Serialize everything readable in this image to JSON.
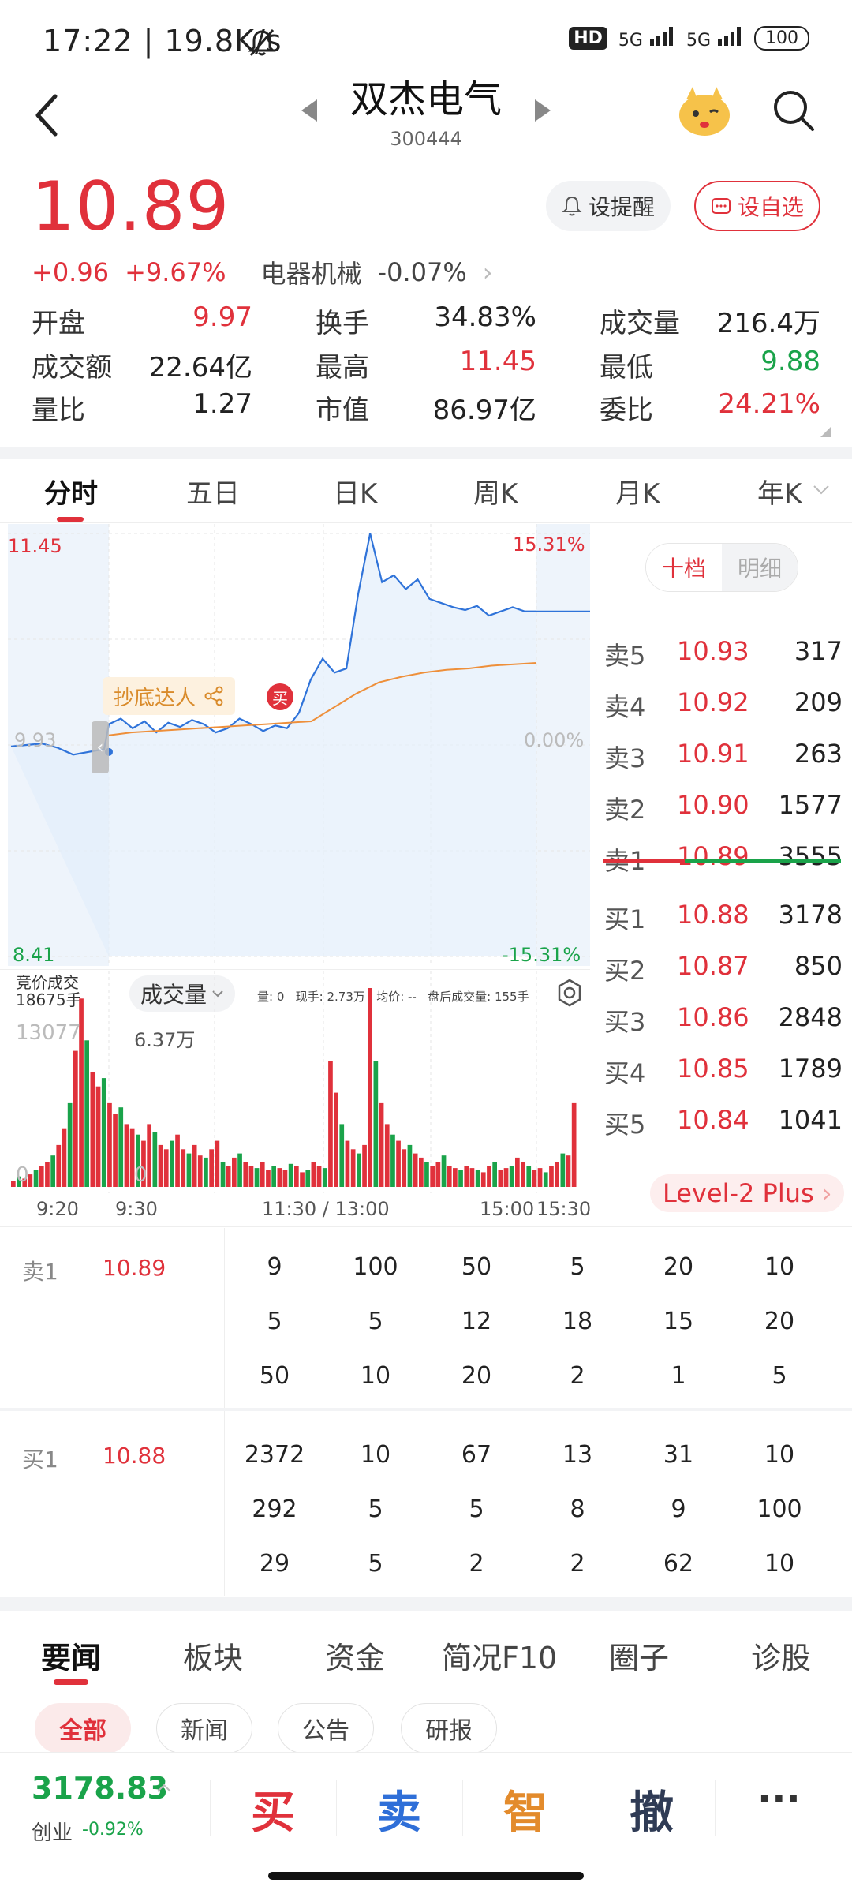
{
  "status_bar": {
    "time_speed": "17:22 | 19.8K/s",
    "network_badge": "HD",
    "signal1": "5G",
    "signal2": "5G",
    "battery": "100"
  },
  "header": {
    "stock_name": "双杰电气",
    "stock_code": "300444"
  },
  "quote": {
    "price": "10.89",
    "change": "+0.96",
    "change_pct": "+9.67%",
    "sector_name": "电器机械",
    "sector_pct": "-0.07%",
    "alert_label": "设提醒",
    "fav_label": "设自选",
    "stats": [
      {
        "label": "开盘",
        "value": "9.97",
        "color": "red"
      },
      {
        "label": "换手",
        "value": "34.83%",
        "color": "black"
      },
      {
        "label": "成交量",
        "value": "216.4万",
        "color": "black"
      },
      {
        "label": "成交额",
        "value": "22.64亿",
        "color": "black"
      },
      {
        "label": "最高",
        "value": "11.45",
        "color": "red"
      },
      {
        "label": "最低",
        "value": "9.88",
        "color": "green"
      },
      {
        "label": "量比",
        "value": "1.27",
        "color": "black"
      },
      {
        "label": "市值",
        "value": "86.97亿",
        "color": "black"
      },
      {
        "label": "委比",
        "value": "24.21%",
        "color": "red"
      }
    ]
  },
  "chart_tabs": [
    "分时",
    "五日",
    "日K",
    "周K",
    "月K",
    "年K"
  ],
  "chart_data": {
    "type": "line",
    "price_axis": {
      "top": "11.45",
      "mid": "9.93",
      "bottom": "8.41"
    },
    "pct_axis": {
      "top": "15.31%",
      "mid": "0.00%",
      "bottom": "-15.31%"
    },
    "x_labels": [
      "9:20",
      "9:30",
      "11:30 / 13:00",
      "15:00",
      "15:30"
    ],
    "price_series": [
      9.92,
      9.93,
      9.94,
      9.91,
      9.86,
      9.88,
      9.9,
      10.08,
      10.12,
      10.05,
      10.1,
      10.02,
      10.09,
      10.06,
      10.11,
      10.08,
      10.02,
      10.05,
      10.12,
      10.08,
      10.03,
      10.07,
      10.05,
      10.16,
      10.4,
      10.55,
      10.45,
      10.48,
      11.02,
      11.45,
      11.1,
      11.15,
      11.05,
      11.12,
      10.98,
      10.95,
      10.92,
      10.9,
      10.93,
      10.86,
      10.89,
      10.92,
      10.89,
      10.89
    ],
    "avg_series": [
      10.0,
      10.02,
      10.03,
      10.04,
      10.05,
      10.06,
      10.07,
      10.08,
      10.09,
      10.1,
      10.2,
      10.3,
      10.38,
      10.42,
      10.45,
      10.47,
      10.48,
      10.5,
      10.51,
      10.52
    ],
    "annotation_label": "抄底达人",
    "buy_marker": "买",
    "auction_label": "竞价成交",
    "auction_volume": "18675手",
    "volume_selector": "成交量",
    "volume_info": "量: 0   现手: 2.73万   均价: --   盘后成交量: 155手",
    "vol_axis_top": "13077",
    "vol_axis_right": "6.37万",
    "vol_axis_zero_left": "0",
    "vol_axis_zero_right": "0",
    "volume_bars": [
      3,
      5,
      4,
      6,
      8,
      10,
      12,
      15,
      20,
      28,
      40,
      65,
      90,
      70,
      55,
      48,
      52,
      40,
      35,
      38,
      30,
      28,
      25,
      22,
      30,
      26,
      20,
      18,
      22,
      25,
      18,
      16,
      20,
      15,
      14,
      18,
      22,
      12,
      10,
      14,
      16,
      12,
      10,
      9,
      12,
      8,
      10,
      9,
      8,
      11,
      10,
      7,
      8,
      12,
      10,
      9,
      60,
      45,
      30,
      22,
      18,
      16,
      20,
      95,
      60,
      40,
      30,
      25,
      22,
      18,
      20,
      16,
      14,
      12,
      10,
      12,
      15,
      10,
      9,
      8,
      10,
      9,
      8,
      7,
      10,
      12,
      8,
      9,
      10,
      14,
      12,
      10,
      8,
      9,
      7,
      10,
      12,
      16,
      15,
      40
    ]
  },
  "order_book": {
    "tab_active": "十档",
    "tab_other": "明细",
    "asks": [
      {
        "label": "卖5",
        "price": "10.93",
        "qty": "317"
      },
      {
        "label": "卖4",
        "price": "10.92",
        "qty": "209"
      },
      {
        "label": "卖3",
        "price": "10.91",
        "qty": "263"
      },
      {
        "label": "卖2",
        "price": "10.90",
        "qty": "1577"
      },
      {
        "label": "卖1",
        "price": "10.89",
        "qty": "3555"
      }
    ],
    "bids": [
      {
        "label": "买1",
        "price": "10.88",
        "qty": "3178"
      },
      {
        "label": "买2",
        "price": "10.87",
        "qty": "850"
      },
      {
        "label": "买3",
        "price": "10.86",
        "qty": "2848"
      },
      {
        "label": "买4",
        "price": "10.85",
        "qty": "1789"
      },
      {
        "label": "买5",
        "price": "10.84",
        "qty": "1041"
      }
    ],
    "level2_label": "Level-2 Plus"
  },
  "queue": {
    "ask_label": "卖1",
    "ask_price": "10.89",
    "ask_rows": [
      [
        "9",
        "100",
        "50",
        "5",
        "20",
        "10"
      ],
      [
        "5",
        "5",
        "12",
        "18",
        "15",
        "20"
      ],
      [
        "50",
        "10",
        "20",
        "2",
        "1",
        "5"
      ]
    ],
    "bid_label": "买1",
    "bid_price": "10.88",
    "bid_rows": [
      [
        "2372",
        "10",
        "67",
        "13",
        "31",
        "10"
      ],
      [
        "292",
        "5",
        "5",
        "8",
        "9",
        "100"
      ],
      [
        "29",
        "5",
        "2",
        "2",
        "62",
        "10"
      ]
    ]
  },
  "news_tabs": [
    "要闻",
    "板块",
    "资金",
    "简况F10",
    "圈子",
    "诊股"
  ],
  "news_chips": [
    "全部",
    "新闻",
    "公告",
    "研报"
  ],
  "bottom": {
    "index_value": "3178.83",
    "index_name": "创业",
    "index_pct": "-0.92%",
    "buy": "买",
    "sell": "卖",
    "smart": "智",
    "cancel": "撤",
    "more": "···"
  }
}
